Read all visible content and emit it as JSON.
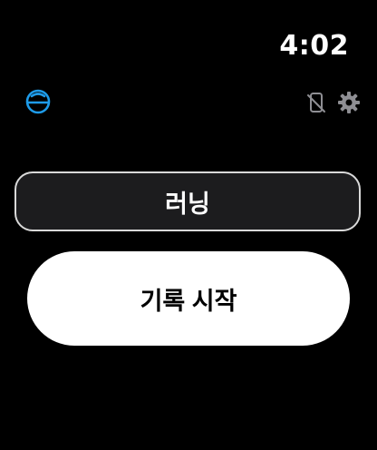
{
  "status_bar": {
    "time": "4:02"
  },
  "header": {
    "logo_icon": "app-logo-icon",
    "phone_disconnected_icon": "phone-disconnected-icon",
    "settings_icon": "gear-icon"
  },
  "main": {
    "activity_label": "러닝",
    "start_button_label": "기록 시작"
  },
  "colors": {
    "background": "#000000",
    "logo_accent": "#1e9be9",
    "activity_bg": "#1c1c1e",
    "activity_border": "#d9d9d9",
    "start_bg": "#ffffff",
    "icon_gray": "#8e8e93"
  }
}
